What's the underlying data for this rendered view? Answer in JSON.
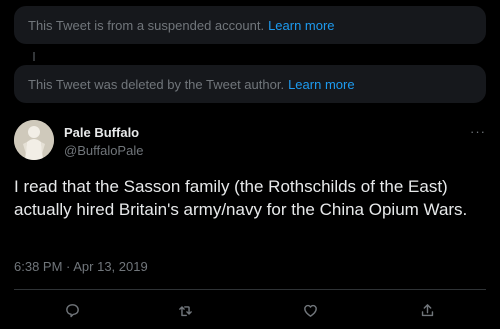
{
  "notices": [
    {
      "text": "This Tweet is from a suspended account.",
      "link": "Learn more"
    },
    {
      "text": "This Tweet was deleted by the Tweet author.",
      "link": "Learn more"
    }
  ],
  "tweet": {
    "author_name": "Pale Buffalo",
    "author_handle": "@BuffaloPale",
    "more_label": "···",
    "text": "I read that the Sasson family (the Rothschilds of the East) actually hired Britain's army/navy for the China Opium Wars.",
    "timestamp": "6:38 PM · Apr 13, 2019"
  },
  "actions": [
    "reply-icon",
    "retweet-icon",
    "like-icon",
    "share-icon"
  ],
  "colors": {
    "background": "#000000",
    "card": "#16181c",
    "link": "#1d9bf0",
    "muted": "#71767b",
    "text": "#e7e9ea"
  }
}
